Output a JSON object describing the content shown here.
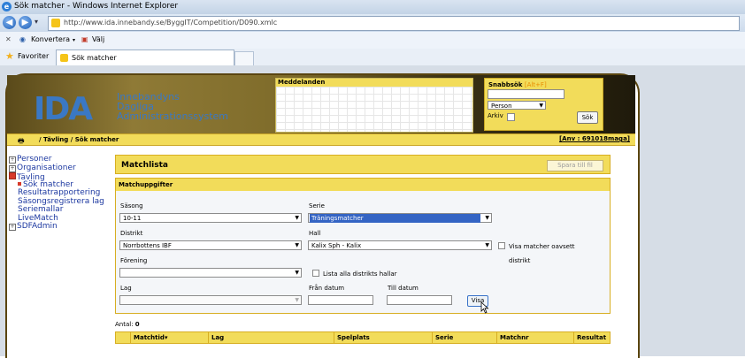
{
  "window": {
    "title": "Sök matcher - Windows Internet Explorer"
  },
  "address": {
    "url": "http://www.ida.innebandy.se/ByggIT/Competition/D090.xmlc"
  },
  "commands": {
    "convert": "Konvertera",
    "select": "Välj",
    "close_glyph": "✕"
  },
  "favorites": {
    "label": "Favoriter",
    "tab_title": "Sök matcher"
  },
  "banner": {
    "logo_text": "IDA",
    "logo_subtitle": [
      "Innebandyns",
      "Dagliga",
      "Administrationssystem"
    ],
    "messages_title": "Meddelanden",
    "quicksearch": {
      "title": "Snabbsök",
      "shortcut": "[Alt+F]",
      "type_value": "Person",
      "archive_label": "Arkiv",
      "button": "Sök"
    }
  },
  "breadcrumb": {
    "text": "/ Tävling / Sök matcher",
    "user": "[Anv : 691018maga]"
  },
  "sidebar": {
    "items": [
      {
        "label": "Personer",
        "expander": "+"
      },
      {
        "label": "Organisationer",
        "expander": "+"
      },
      {
        "label": "Tävling",
        "expander": "-"
      }
    ],
    "tavling_children": [
      "Sök matcher",
      "Resultatrapportering",
      "Säsongsregistrera lag",
      "Seriemallar",
      "LiveMatch"
    ],
    "after": {
      "label": "SDFAdmin",
      "expander": "+"
    }
  },
  "main": {
    "title": "Matchlista",
    "save_button": "Spara till fil",
    "section_title": "Matchuppgifter",
    "fields": {
      "season_label": "Säsong",
      "season_value": "10-11",
      "series_label": "Serie",
      "series_value": "Träningsmatcher",
      "district_label": "Distrikt",
      "district_value": "Norrbottens IBF",
      "hall_label": "Hall",
      "hall_value": "Kalix Sph - Kalix",
      "hall_any_label": "Visa matcher oavsett",
      "hall_any_label2": "distrikt",
      "club_label": "Förening",
      "club_value": "",
      "all_halls_label": "Lista alla distrikts hallar",
      "team_label": "Lag",
      "team_value": "",
      "from_label": "Från datum",
      "to_label": "Till datum",
      "show_button": "Visa"
    },
    "count_label": "Antal:",
    "count_value": "0",
    "columns": [
      "Matchtid",
      "Lag",
      "Spelplats",
      "Serie",
      "Matchnr",
      "Resultat"
    ],
    "sort_indicator": "▾"
  }
}
